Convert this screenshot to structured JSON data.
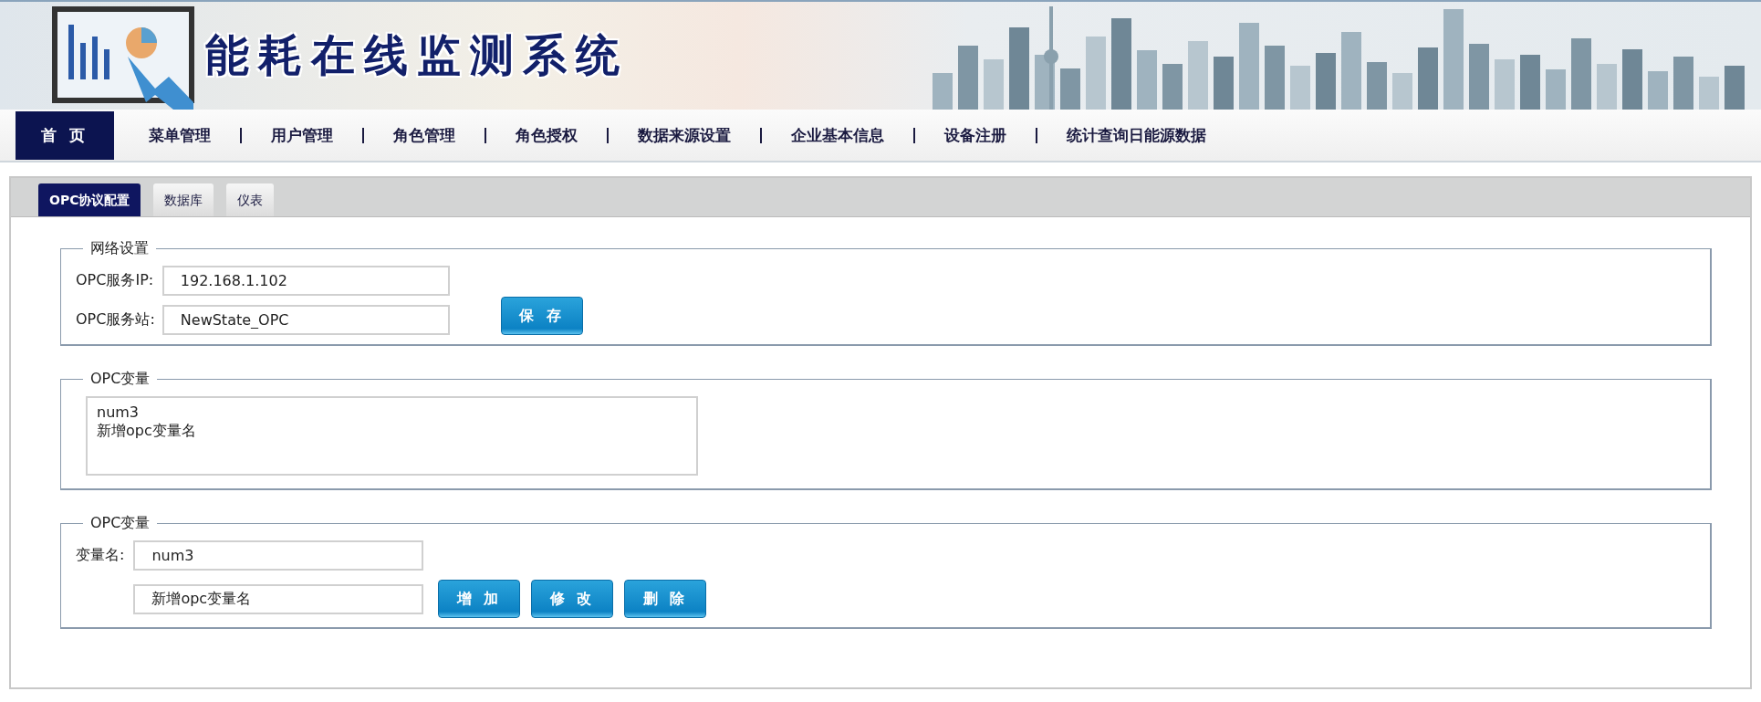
{
  "header": {
    "title": "能耗在线监测系统"
  },
  "nav": [
    {
      "label": "首 页",
      "selected": true
    },
    {
      "label": "菜单管理",
      "selected": false
    },
    {
      "label": "用户管理",
      "selected": false
    },
    {
      "label": "角色管理",
      "selected": false
    },
    {
      "label": "角色授权",
      "selected": false
    },
    {
      "label": "数据来源设置",
      "selected": false
    },
    {
      "label": "企业基本信息",
      "selected": false
    },
    {
      "label": "设备注册",
      "selected": false
    },
    {
      "label": "统计查询日能源数据",
      "selected": false
    }
  ],
  "tabs": [
    {
      "label": "OPC协议配置",
      "selected": true
    },
    {
      "label": "数据库",
      "selected": false
    },
    {
      "label": "仪表",
      "selected": false
    }
  ],
  "network_settings": {
    "legend": "网络设置",
    "fields": [
      {
        "label": "OPC服务IP:",
        "value": "192.168.1.102"
      },
      {
        "label": "OPC服务站:",
        "value": "NewState_OPC"
      }
    ],
    "save_button": "保 存"
  },
  "variable_list": {
    "legend": "OPC变量",
    "items": [
      "num3",
      "新增opc变量名"
    ]
  },
  "variable_editor": {
    "legend": "OPC变量",
    "label": "变量名:",
    "fields": [
      {
        "value": "num3"
      },
      {
        "value": "新增opc变量名"
      }
    ],
    "buttons": [
      "增 加",
      "修 改",
      "删 除"
    ]
  }
}
